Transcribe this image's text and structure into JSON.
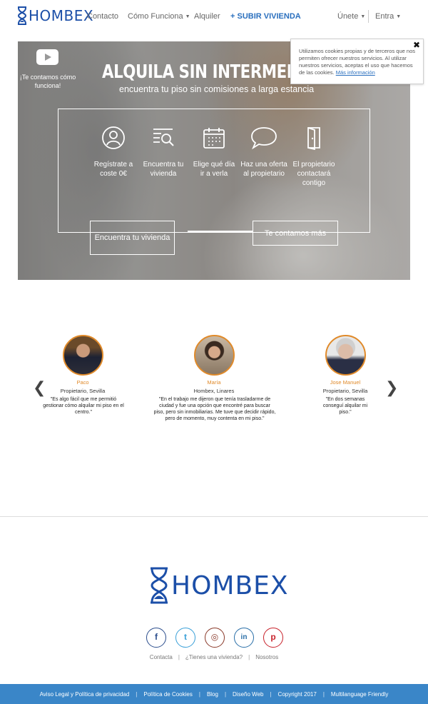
{
  "brand": {
    "logo_text": "HOMBEX",
    "primary_color": "#1c4fa8",
    "accent_color": "#e08a2a"
  },
  "nav": {
    "contacto": "Contacto",
    "como_funciona": "Cómo Funciona",
    "alquiler": "Alquiler",
    "subir_vivienda": "SUBIR VIVIENDA",
    "unete": "Únete",
    "entra": "Entra"
  },
  "hero": {
    "video_caption": "¡Te contamos cómo funciona!",
    "title": "ALQUILA SIN INTERMEDIA",
    "subtitle": "encuentra tu piso sin comisiones a larga estancia",
    "steps": [
      {
        "icon": "user-circle-icon",
        "label": "Regístrate a coste 0€"
      },
      {
        "icon": "search-list-icon",
        "label": "Encuentra tu vivienda"
      },
      {
        "icon": "calendar-icon",
        "label": "Elige qué día ir a verla"
      },
      {
        "icon": "speech-bubble-icon",
        "label": "Haz una oferta al propietario"
      },
      {
        "icon": "door-icon",
        "label": "El propietario contactará contigo"
      }
    ],
    "btn_find": "Encuentra tu vivienda",
    "btn_tell": "Te contamos más"
  },
  "cookie": {
    "text": "Utilizamos cookies propias y de terceros que nos permiten ofrecer nuestros servicios. Al utilizar nuestros servicios, aceptas el uso que hacemos de las cookies.",
    "link": "Más información",
    "close": "✖"
  },
  "testimonials": [
    {
      "name": "Paco",
      "role": "Propietario, Sevilla",
      "quote": "\"Es algo fácil que me permitió gestionar cómo alquilar mi piso en el centro.\""
    },
    {
      "name": "María",
      "role": "Hombex, Linares",
      "quote": "\"En el trabajo me dijeron que tenía trasladarme de ciudad y fue una opción que encontré para buscar piso, pero sin inmobiliarias. Me tuve que decidir rápido, pero de momento, muy contenta en mi piso.\""
    },
    {
      "name": "Jose Manuel",
      "role": "Propietario, Sevilla",
      "quote": "\"En dos semanas conseguí alquilar mi piso.\""
    }
  ],
  "social": [
    {
      "icon": "facebook-icon",
      "glyph": "f",
      "color": "#2d4f8e"
    },
    {
      "icon": "twitter-icon",
      "glyph": "t",
      "color": "#3aa0d8"
    },
    {
      "icon": "instagram-icon",
      "glyph": "◎",
      "color": "#8a3a2a"
    },
    {
      "icon": "linkedin-icon",
      "glyph": "in",
      "color": "#2a6fa8"
    },
    {
      "icon": "pinterest-icon",
      "glyph": "p",
      "color": "#c8232c"
    }
  ],
  "footer_links": [
    "Contacta",
    "¿Tienes una vivienda?",
    "Nosotros"
  ],
  "bottom_links": [
    "Aviso Legal y Política de privacidad",
    "Política de Cookies",
    "Blog",
    "Diseño Web",
    "Copyright 2017",
    "Multilanguage Friendly"
  ]
}
